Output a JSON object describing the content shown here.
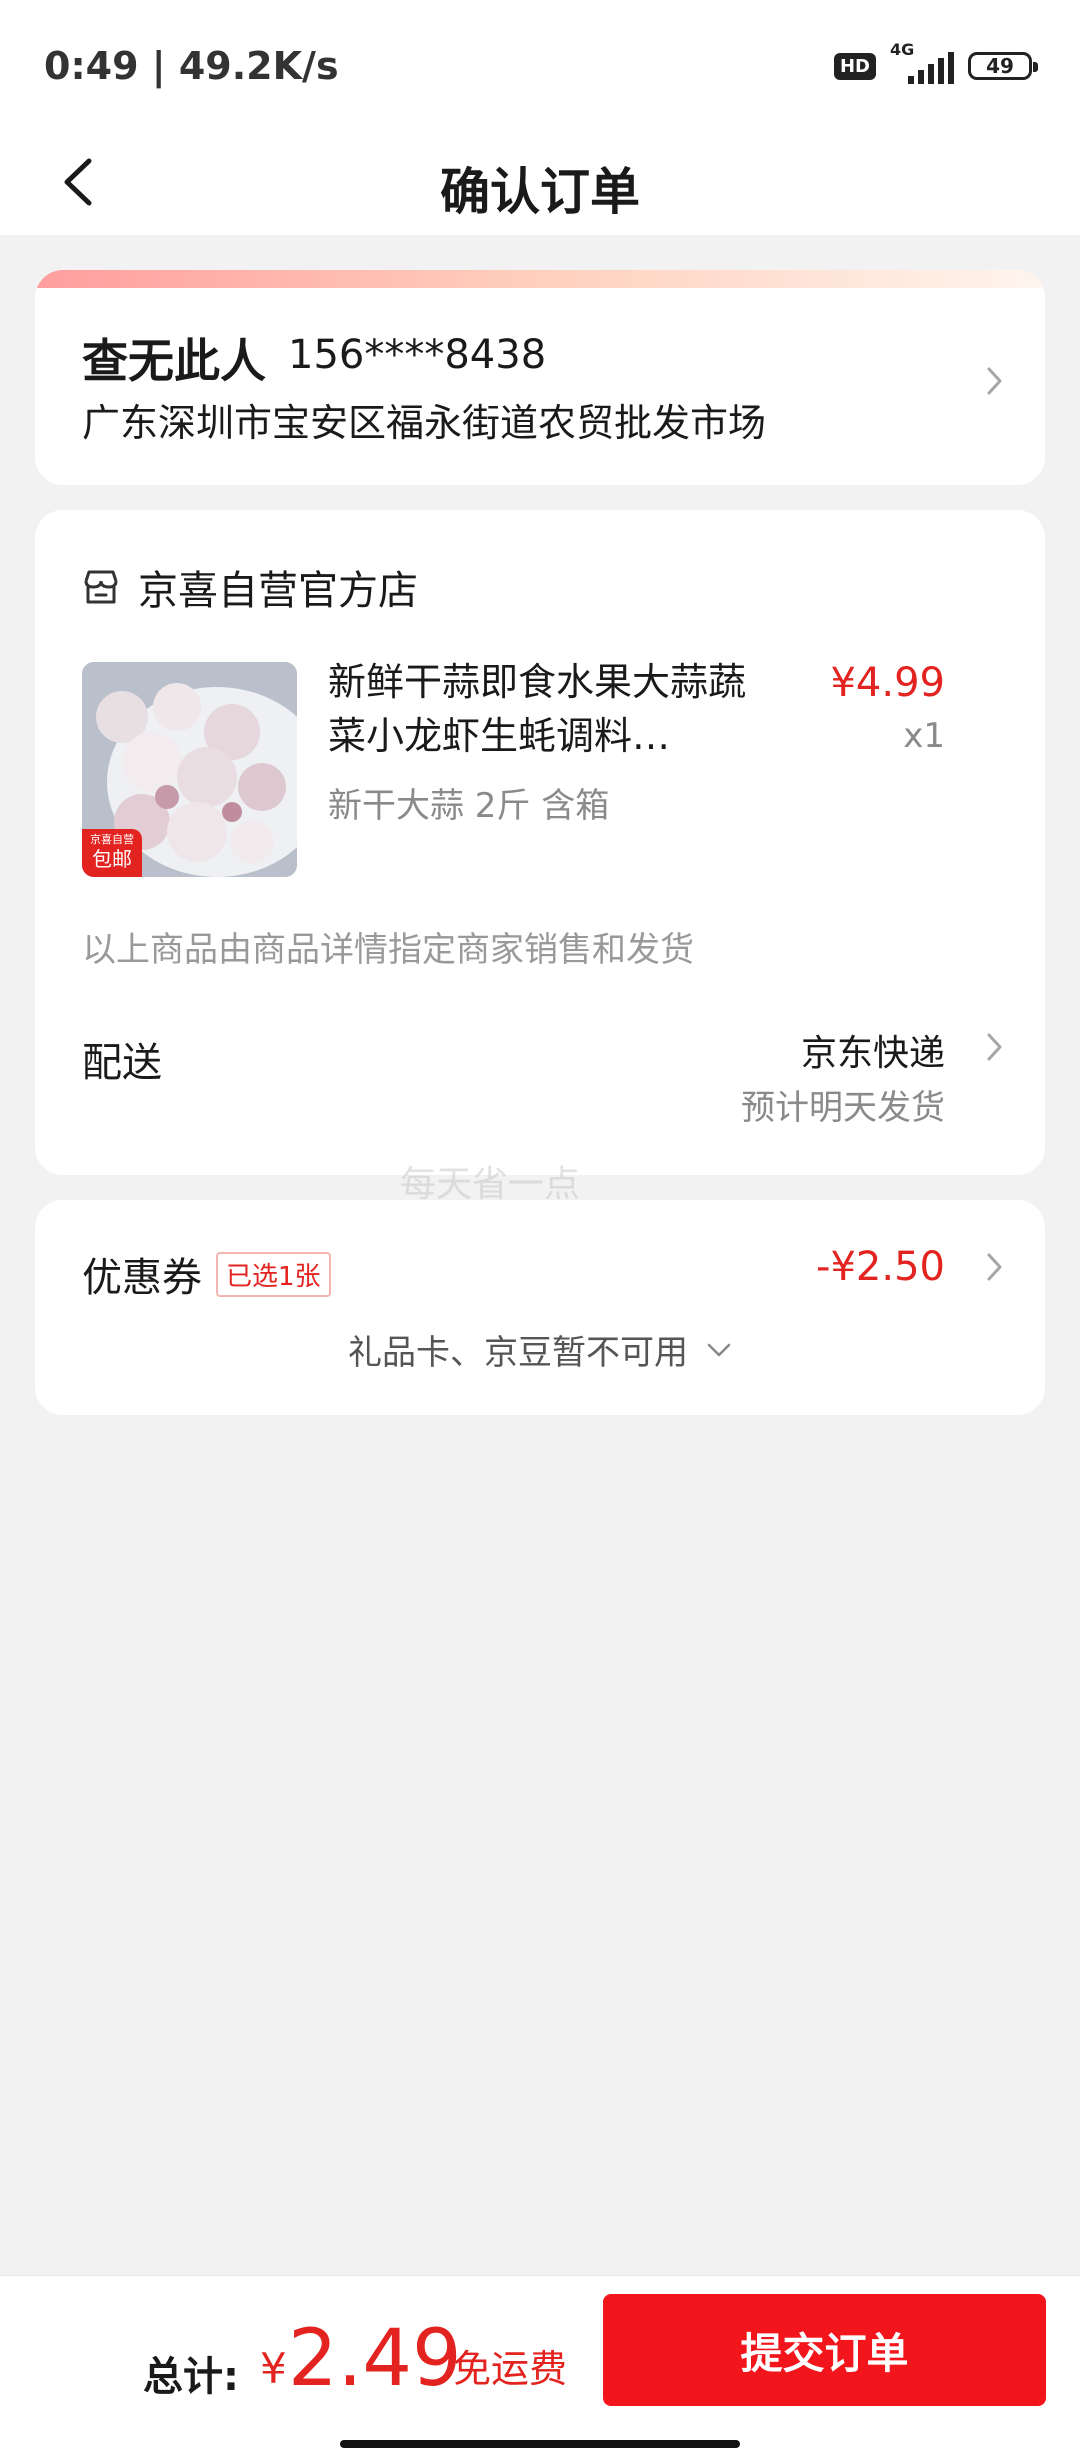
{
  "status_bar": {
    "time_speed": "0:49 | 49.2K/s",
    "hd": "HD",
    "network": "4G",
    "battery": "49"
  },
  "header": {
    "title": "确认订单",
    "back_icon": "chevron-left-icon"
  },
  "address": {
    "name": "查无此人",
    "phone": "156****8438",
    "detail": "广东深圳市宝安区福永街道农贸批发市场"
  },
  "store": {
    "icon": "store-icon",
    "name": "京喜自营官方店"
  },
  "product": {
    "title": "新鲜干蒜即食水果大蒜蔬菜小龙虾生蚝调料…",
    "spec": "新干大蒜 2斤 含箱",
    "price": "¥4.99",
    "qty": "x1",
    "tag_line1": "京喜自营",
    "tag_line2": "包邮"
  },
  "seller_note": "以上商品由商品详情指定商家销售和发货",
  "delivery": {
    "label": "配送",
    "method": "京东快递",
    "estimate": "预计明天发货"
  },
  "watermark": "每天省一点",
  "coupon": {
    "label": "优惠券",
    "badge": "已选1张",
    "amount": "-¥2.50",
    "gift_text": "礼品卡、京豆暂不可用"
  },
  "footer": {
    "total_label": "总计:",
    "currency": "¥",
    "total": "2.49",
    "free_shipping": "免运费",
    "submit": "提交订单"
  },
  "colors": {
    "accent": "#e3231f",
    "button": "#f2151b",
    "background": "#f2f2f2"
  }
}
